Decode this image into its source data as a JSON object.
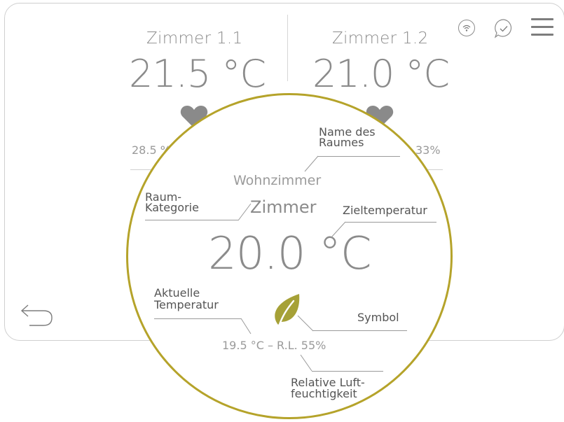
{
  "rooms": [
    {
      "name": "Zimmer 1.1",
      "temperature": "21.5 °C",
      "humidity": "28.5 %"
    },
    {
      "name": "Zimmer 1.2",
      "temperature": "21.0 °C",
      "humidity": "33%"
    }
  ],
  "header_icons": [
    "wifi-icon",
    "chat-check-icon",
    "hamburger-menu-icon"
  ],
  "nav": {
    "back_icon": "back-arrow-icon"
  },
  "zoom": {
    "room_name": "Wohnzimmer",
    "room_category": "Zimmer",
    "target_temperature": "20.0 °C",
    "current_reading": "19.5 °C – R.L. 55%",
    "symbol_icon": "leaf-icon"
  },
  "callouts": {
    "name_line1": "Name des",
    "name_line2": "Raumes",
    "category_line1": "Raum-",
    "category_line2": "Kategorie",
    "target": "Zieltemperatur",
    "current_line1": "Aktuelle",
    "current_line2": "Temperatur",
    "symbol": "Symbol",
    "humidity_line1": "Relative Luft-",
    "humidity_line2": "feuchtigkeit"
  },
  "colors": {
    "accent": "#b5a32a",
    "leaf": "#a6a137",
    "text": "#8b8b8b",
    "heart": "#8a8a8a"
  }
}
